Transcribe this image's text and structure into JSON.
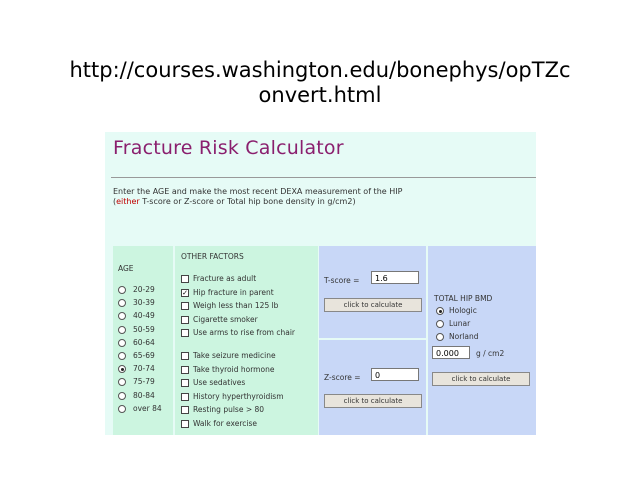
{
  "slide": {
    "url_line1": "http://courses.washington.edu/bonephys/opTZc",
    "url_line2": "onvert.html"
  },
  "calculator": {
    "title": "Fracture Risk Calculator",
    "instruction_line1": "Enter the AGE and make the most recent DEXA measurement of the HIP",
    "instruction_line2_prefix": "(",
    "instruction_line2_emph": "either",
    "instruction_line2_rest": " T-score or Z-score or Total hip bone density in g/cm2)"
  },
  "age": {
    "label": "AGE",
    "options": [
      "20-29",
      "30-39",
      "40-49",
      "50-59",
      "60-64",
      "65-69",
      "70-74",
      "75-79",
      "80-84",
      "over 84"
    ],
    "selected_index": 6
  },
  "risk_factors": {
    "label": "OTHER FACTORS",
    "group1": [
      {
        "label": "Fracture as adult",
        "checked": false
      },
      {
        "label": "Hip fracture in parent",
        "checked": true
      },
      {
        "label": "Weigh less than 125 lb",
        "checked": false
      },
      {
        "label": "Cigarette smoker",
        "checked": false
      },
      {
        "label": "Use arms to rise from chair",
        "checked": false
      }
    ],
    "group2": [
      {
        "label": "Take seizure medicine",
        "checked": false
      },
      {
        "label": "Take thyroid hormone",
        "checked": false
      },
      {
        "label": "Use sedatives",
        "checked": false
      },
      {
        "label": "History hyperthyroidism",
        "checked": false
      },
      {
        "label": "Resting pulse > 80",
        "checked": false
      },
      {
        "label": "Walk for exercise",
        "checked": false
      }
    ]
  },
  "tscore": {
    "label": "T-score =",
    "value": "1.6",
    "button": "click to calculate"
  },
  "zscore": {
    "label": "Z-score =",
    "value": "0",
    "button": "click to calculate"
  },
  "bmd": {
    "label": "TOTAL HIP BMD",
    "options": [
      "Hologic",
      "Lunar",
      "Norland"
    ],
    "selected_index": 0,
    "value": "0.000",
    "units": "g / cm2",
    "button": "click to calculate"
  }
}
